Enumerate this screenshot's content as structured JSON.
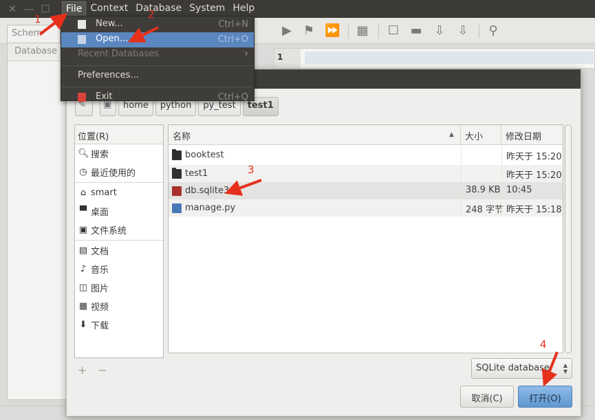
{
  "window": {
    "menu": [
      "File",
      "Context",
      "Database",
      "System",
      "Help"
    ],
    "schema_tab": "Schem",
    "db_header": "Database",
    "grid_row_num": "1"
  },
  "file_menu": {
    "items": [
      {
        "label": "New...",
        "shortcut": "Ctrl+N"
      },
      {
        "label": "Open...",
        "shortcut": "Ctrl+O"
      },
      {
        "label": "Recent Databases"
      },
      {
        "label": "Preferences..."
      },
      {
        "label": "Exit",
        "shortcut": "Ctrl+Q"
      }
    ]
  },
  "dialog": {
    "path": [
      "home",
      "python",
      "py_test",
      "test1"
    ],
    "places_header": "位置(R)",
    "places": [
      {
        "label": "搜索",
        "icon": "search-icon"
      },
      {
        "label": "最近使用的",
        "icon": "clock-icon"
      },
      {
        "label": "smart",
        "icon": "home-icon"
      },
      {
        "label": "桌面",
        "icon": "desktop-icon"
      },
      {
        "label": "文件系统",
        "icon": "drive-icon"
      },
      {
        "label": "文档",
        "icon": "document-icon"
      },
      {
        "label": "音乐",
        "icon": "music-icon"
      },
      {
        "label": "图片",
        "icon": "picture-icon"
      },
      {
        "label": "视频",
        "icon": "video-icon"
      },
      {
        "label": "下载",
        "icon": "download-icon"
      }
    ],
    "add_symbol": "+",
    "remove_symbol": "−",
    "columns": [
      "名称",
      "大小",
      "修改日期"
    ],
    "files": [
      {
        "name": "booktest",
        "size": "",
        "date": "昨天于 15:20",
        "type": "folder"
      },
      {
        "name": "test1",
        "size": "",
        "date": "昨天于 15:20",
        "type": "folder"
      },
      {
        "name": "db.sqlite3",
        "size": "38.9 KB",
        "date": "10:45",
        "type": "database"
      },
      {
        "name": "manage.py",
        "size": "248 字节",
        "date": "昨天于 15:18",
        "type": "python"
      }
    ],
    "filter": "SQLite database",
    "cancel": "取消(C)",
    "open": "打开(O)"
  },
  "annotations": [
    "1",
    "2",
    "3",
    "4"
  ],
  "colors": {
    "accent": "#5b87c1",
    "annotation": "#e6301c",
    "menubar": "#3b3a36"
  }
}
